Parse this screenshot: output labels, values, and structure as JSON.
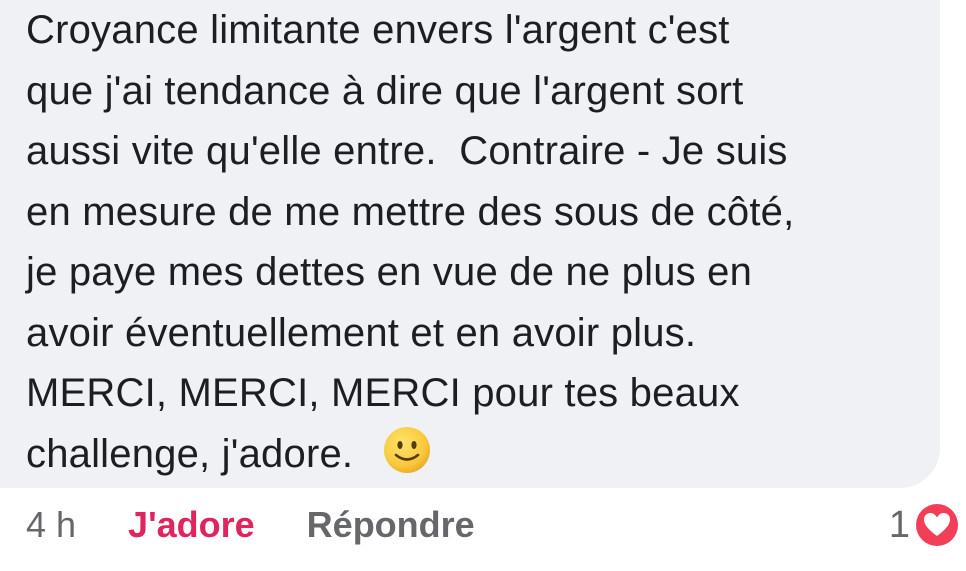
{
  "comment": {
    "lines": [
      "Croyance limitante envers l'argent c'est",
      "que j'ai tendance à dire que l'argent sort",
      "aussi vite qu'elle entre.  Contraire - Je suis",
      "en mesure de me mettre des sous de côté,",
      "je paye mes dettes en vue de ne plus en",
      "avoir éventuellement et en avoir plus.",
      "MERCI, MERCI, MERCI pour tes beaux",
      "challenge, j'adore."
    ],
    "emoji": "slightly-smiling-face-icon"
  },
  "actions": {
    "timestamp": "4 h",
    "love_label": "J'adore",
    "reply_label": "Répondre"
  },
  "reaction": {
    "count": "1",
    "icon": "heart-icon"
  },
  "colors": {
    "bubble": "#f0f1f4",
    "text": "#1c1e21",
    "muted": "#65676b",
    "love": "#e0245e",
    "heart": "#f33e58",
    "emoji": "#f7c23c"
  }
}
